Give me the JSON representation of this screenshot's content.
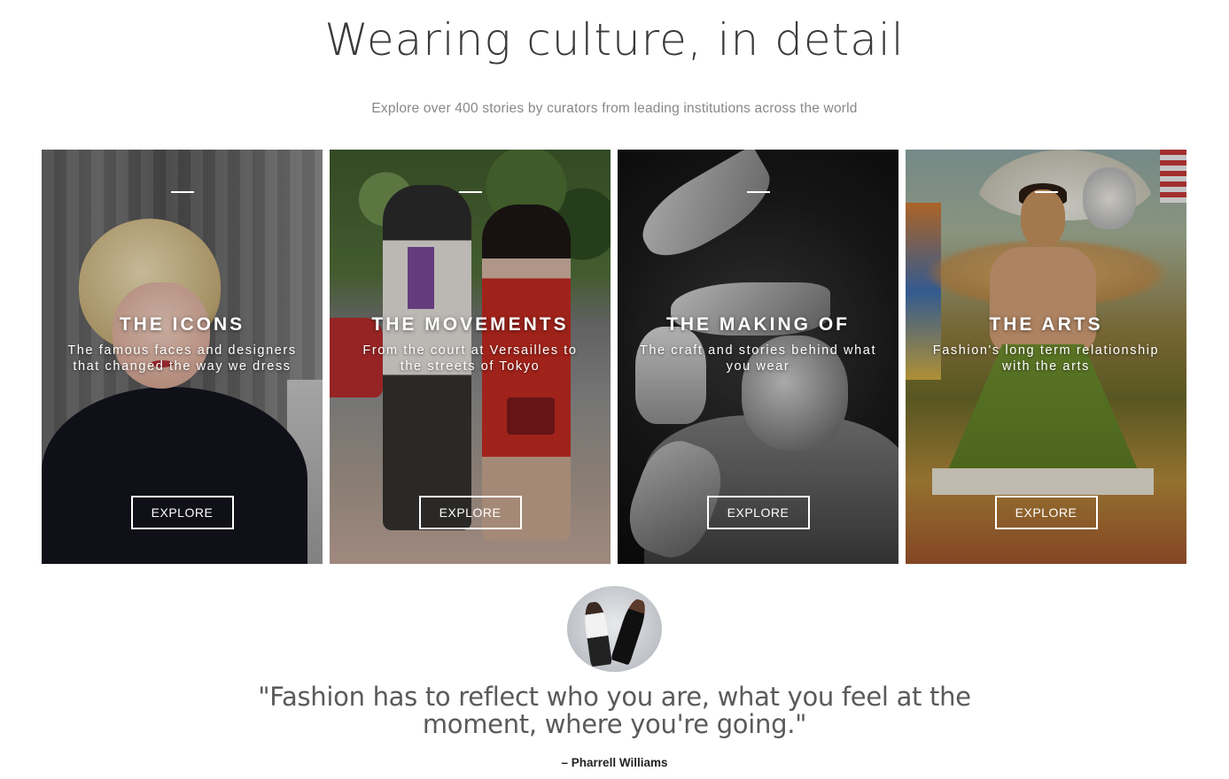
{
  "header": {
    "title": "Wearing culture, in detail",
    "subtitle": "Explore over 400 stories by curators from leading institutions across the world"
  },
  "cards": [
    {
      "title": "THE ICONS",
      "description_line1": "The famous faces and designers",
      "description_line2": "that changed the way we dress",
      "button": "EXPLORE"
    },
    {
      "title": "THE MOVEMENTS",
      "description_line1": "From the court at Versailles to",
      "description_line2": "the streets of Tokyo",
      "button": "EXPLORE"
    },
    {
      "title": "THE MAKING OF",
      "description_line1": "The craft and stories behind what",
      "description_line2": "you wear",
      "button": "EXPLORE"
    },
    {
      "title": "THE ARTS",
      "description_line1": "Fashion's long term relationship",
      "description_line2": "with the arts",
      "button": "EXPLORE"
    }
  ],
  "testimonial": {
    "quote_line1": "\"Fashion has to reflect who you are, what you feel at the",
    "quote_line2": "moment, where you're going.\"",
    "author": "– Pharrell Williams"
  }
}
